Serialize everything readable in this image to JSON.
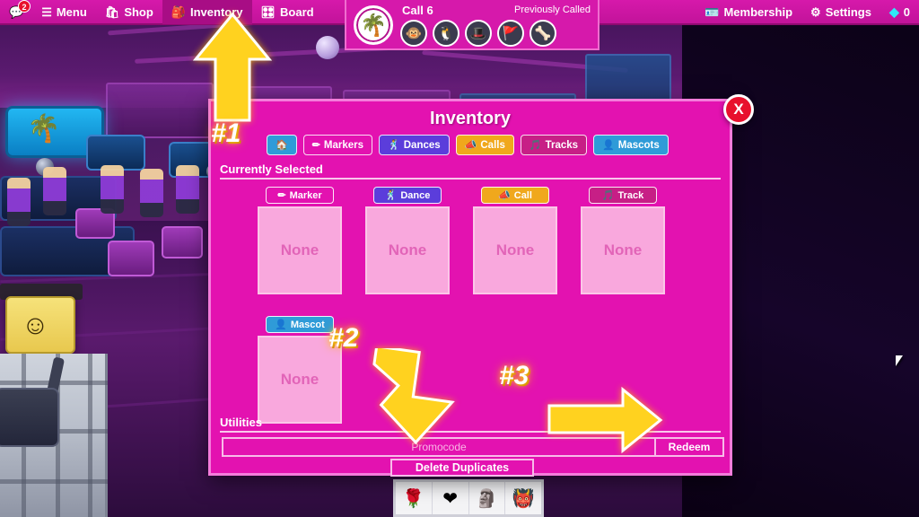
{
  "topbar": {
    "items": [
      {
        "name": "chat",
        "icon": "💬",
        "label": "",
        "badge": "2"
      },
      {
        "name": "menu",
        "icon": "☰",
        "label": "Menu",
        "badge": ""
      },
      {
        "name": "shop",
        "icon": "🛍",
        "label": "Shop",
        "badge": ""
      },
      {
        "name": "inventory",
        "icon": "🎒",
        "label": "Inventory",
        "badge": ""
      },
      {
        "name": "board",
        "icon": "🎛",
        "label": "Board",
        "badge": ""
      }
    ],
    "right_items": [
      {
        "name": "membership",
        "icon": "🪪",
        "label": "Membership"
      },
      {
        "name": "settings",
        "icon": "⚙",
        "label": "Settings"
      }
    ],
    "currency": {
      "icon": "◆",
      "amount": "0"
    }
  },
  "call_banner": {
    "avatar_icon": "🌴",
    "title": "Call 6",
    "previously_called": "Previously Called",
    "slots": [
      "🐵",
      "🐧",
      "🎩",
      "🚩",
      "🦴"
    ]
  },
  "inventory": {
    "title": "Inventory",
    "close_label": "X",
    "tabs": [
      {
        "name": "home",
        "icon": "🏠",
        "label": "",
        "color": "#2f9bd8"
      },
      {
        "name": "markers",
        "icon": "✏",
        "label": "Markers",
        "color": "#e312b0"
      },
      {
        "name": "dances",
        "icon": "🕺",
        "label": "Dances",
        "color": "#5b3ddb"
      },
      {
        "name": "calls",
        "icon": "📣",
        "label": "Calls",
        "color": "#f0a81c"
      },
      {
        "name": "tracks",
        "icon": "🎵",
        "label": "Tracks",
        "color": "#c71f86"
      },
      {
        "name": "mascots",
        "icon": "👤",
        "label": "Mascots",
        "color": "#2f9bd8"
      }
    ],
    "currently_selected_label": "Currently Selected",
    "slots_row1": [
      {
        "tag": "Marker",
        "tag_icon": "✏",
        "tag_color": "#e312b0",
        "value": "None"
      },
      {
        "tag": "Dance",
        "tag_icon": "🕺",
        "tag_color": "#5b3ddb",
        "value": "None"
      },
      {
        "tag": "Call",
        "tag_icon": "📣",
        "tag_color": "#f0a81c",
        "value": "None"
      },
      {
        "tag": "Track",
        "tag_icon": "🎵",
        "tag_color": "#c71f86",
        "value": "None"
      }
    ],
    "slots_row2": [
      {
        "tag": "Mascot",
        "tag_icon": "👤",
        "tag_color": "#2f9bd8",
        "value": "None"
      }
    ],
    "utilities_label": "Utilities",
    "promocode_placeholder": "Promocode",
    "promocode_value": "",
    "redeem_label": "Redeem",
    "delete_duplicates_label": "Delete Duplicates"
  },
  "annotations": [
    {
      "name": "step-1",
      "label": "#1"
    },
    {
      "name": "step-2",
      "label": "#2"
    },
    {
      "name": "step-3",
      "label": "#3"
    }
  ],
  "hotbar": {
    "items": [
      "🌹",
      "❤",
      "🗿",
      "👹"
    ]
  },
  "colors": {
    "brand_pink": "#e312b0",
    "topbar_pink": "#d619ab",
    "slot_fill": "#f9a8dd",
    "anno_yellow": "#ffd21f",
    "close_red": "#e8112d"
  }
}
